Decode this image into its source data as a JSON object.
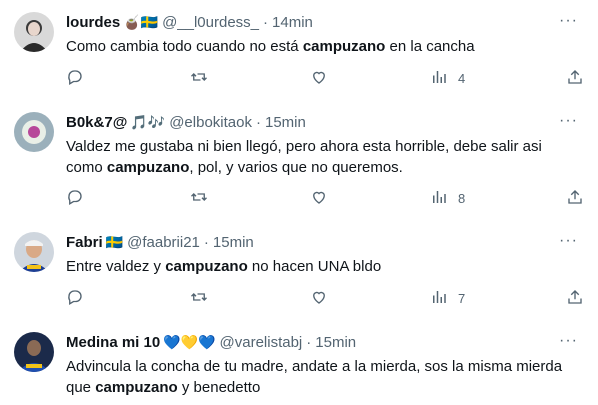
{
  "tweets": [
    {
      "name": "lourdes",
      "emojis": "🧉🇸🇪",
      "handle": "@__l0urdess_",
      "time": "14min",
      "text_parts": [
        "Como cambia todo cuando no está ",
        "campuzano",
        " en la cancha"
      ],
      "views": "4",
      "avatar_color": "#d8d8d8"
    },
    {
      "name": "B0k&7@",
      "emojis": "🎵🎶",
      "handle": "@elbokitaok",
      "time": "15min",
      "text_parts": [
        "Valdez me gustaba ni bien llegó, pero ahora esta horrible, debe salir asi como ",
        "campuzano",
        ", pol, y varios que no queremos."
      ],
      "views": "8",
      "avatar_color": "#6f8a9a"
    },
    {
      "name": "Fabri",
      "emojis": "🇸🇪",
      "handle": "@faabrii21",
      "time": "15min",
      "text_parts": [
        "Entre valdez y ",
        "campuzano",
        " no hacen UNA bldo"
      ],
      "views": "7",
      "avatar_color": "#c9a98a"
    },
    {
      "name": "Medina mi 10",
      "emojis": "💙💛💙",
      "handle": "@varelistabj",
      "time": "15min",
      "text_parts": [
        "Advincula la concha de tu madre, andate a la mierda, sos la misma mierda que ",
        "campuzano",
        " y benedetto"
      ],
      "views": "",
      "avatar_color": "#1c3b7a"
    }
  ],
  "icons": {
    "reply": "reply-icon",
    "retweet": "retweet-icon",
    "like": "like-icon",
    "views": "views-icon",
    "share": "share-icon",
    "more": "more-icon"
  },
  "more_glyph": "···"
}
